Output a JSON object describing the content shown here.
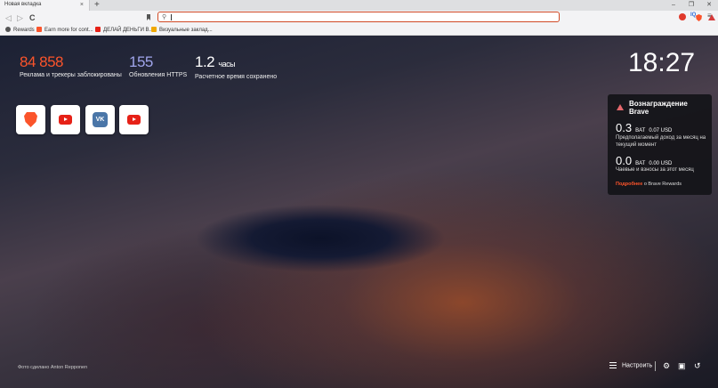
{
  "tab": {
    "title": "Новая вкладка",
    "close": "×",
    "new": "+"
  },
  "window": {
    "minimize": "–",
    "maximize": "❐",
    "close": "✕"
  },
  "nav": {
    "back": "◁",
    "forward": "▷",
    "reload": "C",
    "menu": "≡"
  },
  "urlbar": {
    "value": "",
    "search_glyph": "⚲"
  },
  "extensions": {
    "ext2": "IQ"
  },
  "bookmarks": [
    {
      "label": "Rewards",
      "color": "#555555"
    },
    {
      "label": "Earn more for cont...",
      "color": "#fb542b"
    },
    {
      "label": "ДЕЛАЙ ДЕНЬГИ В...",
      "color": "#e62117"
    },
    {
      "label": "Визуальные заклад...",
      "color": "#f0a800"
    }
  ],
  "stats": [
    {
      "value": "84 858",
      "unit": "",
      "label": "Реклама и трекеры заблокированы",
      "color": "#fb542b"
    },
    {
      "value": "155",
      "unit": "",
      "label": "Обновления HTTPS",
      "color": "#a0a5eb"
    },
    {
      "value": "1.2",
      "unit": "часы",
      "label": "Расчетное время сохранено",
      "color": "#ffffff"
    }
  ],
  "clock": "18:27",
  "tiles": [
    "brave-site",
    "youtube",
    "vk",
    "youtube"
  ],
  "vk_text": "VK",
  "rewards": {
    "title": "Вознаграждение Brave",
    "earnings_value": "0.3",
    "earnings_unit": "BAT",
    "earnings_usd": "0.07 USD",
    "earnings_desc": "Предполагаемый доход за месяц на текущий момент",
    "tips_value": "0.0",
    "tips_unit": "BAT",
    "tips_usd": "0.00 USD",
    "tips_desc": "Чаевые и взносы за этот месяц",
    "more_link": "Подробнее",
    "more_text": " о Brave Rewards"
  },
  "photo_credit": "Фото сделано Anton Repponen",
  "footer": {
    "customize": "Настроить",
    "settings": "⚙",
    "bookmarks": "▣",
    "history": "↺"
  }
}
